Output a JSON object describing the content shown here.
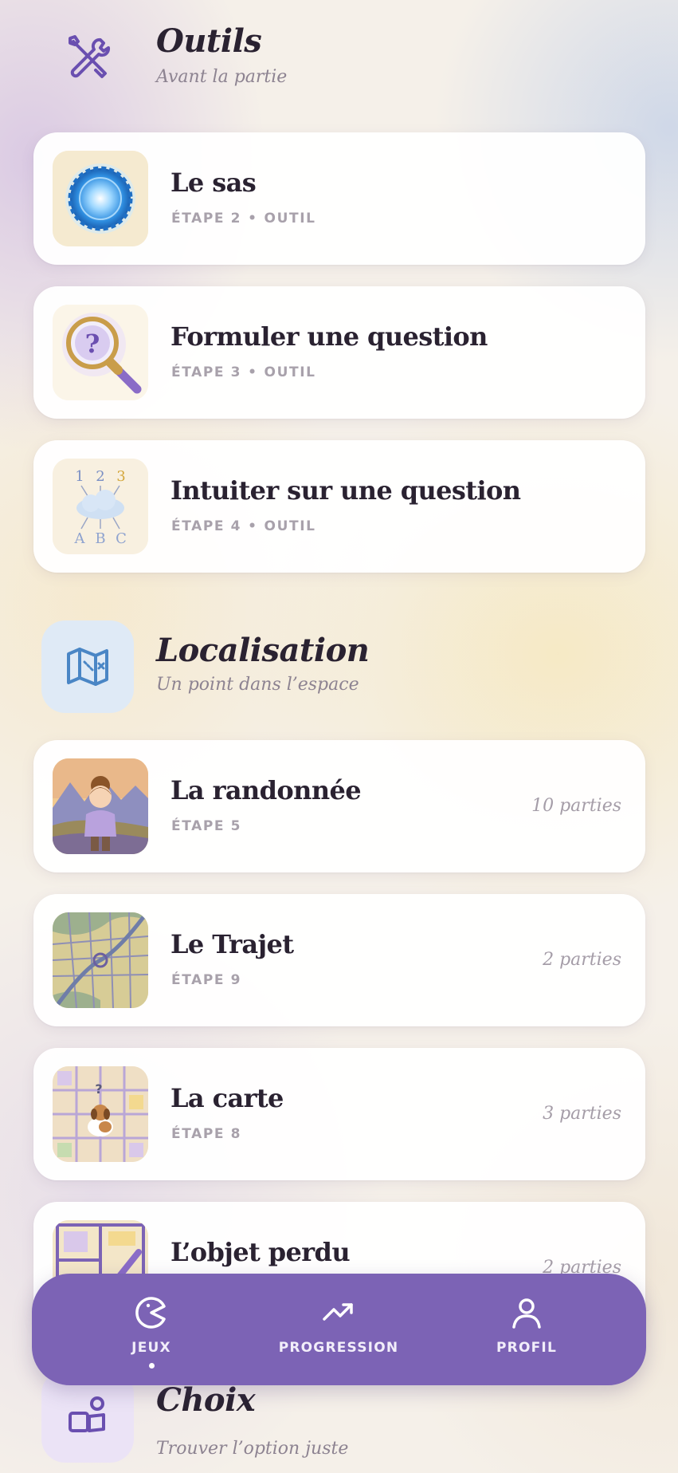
{
  "sections": {
    "outils": {
      "title": "Outils",
      "subtitle": "Avant la partie",
      "icon": "wrench-screwdriver-icon"
    },
    "localisation": {
      "title": "Localisation",
      "subtitle": "Un point dans l’espace",
      "icon": "map-icon"
    },
    "choix": {
      "title": "Choix",
      "subtitle": "Trouver l’option juste",
      "icon": "shapes-icon"
    }
  },
  "outils_cards": [
    {
      "title": "Le sas",
      "step": "ÉTAPE 2",
      "kind": "OUTIL",
      "thumb": "portal-thumbnail"
    },
    {
      "title": "Formuler une question",
      "step": "ÉTAPE 3",
      "kind": "OUTIL",
      "thumb": "magnifier-question-thumbnail"
    },
    {
      "title": "Intuiter sur une question",
      "step": "ÉTAPE 4",
      "kind": "OUTIL",
      "thumb": "cloud-123-abc-thumbnail"
    }
  ],
  "localisation_cards": [
    {
      "title": "La randonnée",
      "step": "ÉTAPE 5",
      "count": "10 parties",
      "thumb": "hiker-girl-thumbnail"
    },
    {
      "title": "Le Trajet",
      "step": "ÉTAPE 9",
      "count": "2 parties",
      "thumb": "city-map-thumbnail"
    },
    {
      "title": "La carte",
      "step": "ÉTAPE 8",
      "count": "3 parties",
      "thumb": "dog-map-thumbnail"
    },
    {
      "title": "L’objet perdu",
      "count": "2 parties",
      "thumb": "floor-plan-thumbnail"
    }
  ],
  "nav": {
    "items": [
      {
        "label": "JEUX",
        "icon": "pacman-icon",
        "active": true
      },
      {
        "label": "PROGRESSION",
        "icon": "trend-up-icon",
        "active": false
      },
      {
        "label": "PROFIL",
        "icon": "user-icon",
        "active": false
      }
    ]
  },
  "colors": {
    "accent": "#7c63b5",
    "title_text": "#2a2231",
    "meta_text": "#a8a1ab",
    "map_icon_blue": "#4a86c5",
    "tools_icon_purple": "#6a4fb0"
  }
}
